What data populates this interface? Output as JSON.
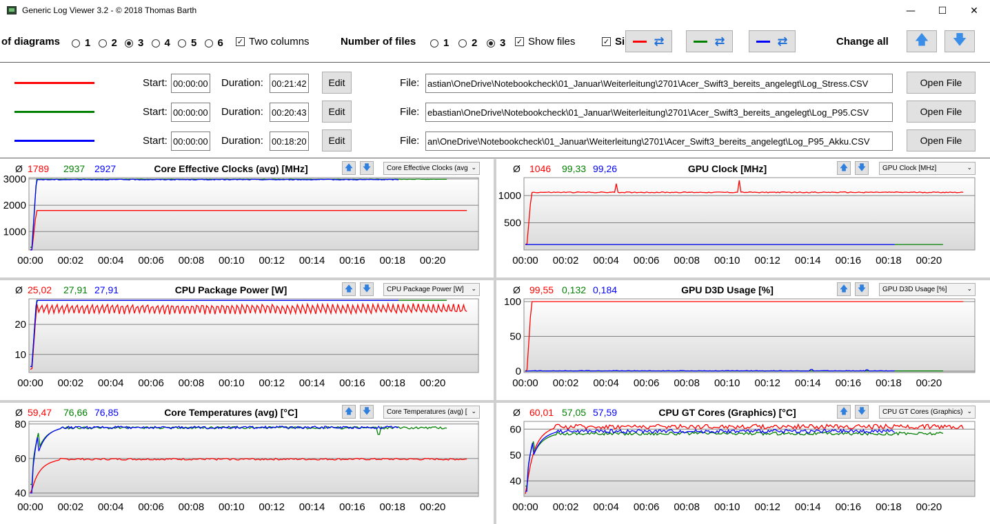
{
  "window": {
    "title": "Generic Log Viewer 3.2 - © 2018 Thomas Barth",
    "minimize": "—",
    "maximize": "☐",
    "close": "✕"
  },
  "toolbar": {
    "diagrams_label": "of diagrams",
    "diagram_options": [
      "1",
      "2",
      "3",
      "4",
      "5",
      "6"
    ],
    "diagram_selected": "3",
    "two_columns_label": "Two columns",
    "two_columns_checked": true,
    "files_label": "Number of files",
    "file_options": [
      "1",
      "2",
      "3"
    ],
    "files_selected": "3",
    "show_files_label": "Show files",
    "show_files_checked": true,
    "si_label": "Si",
    "si_checked": true,
    "change_all_label": "Change all",
    "check_glyph": "✓"
  },
  "files": [
    {
      "color": "#ff0000",
      "start_label": "Start:",
      "start": "00:00:00",
      "duration_label": "Duration:",
      "duration": "00:21:42",
      "edit_label": "Edit",
      "file_label": "File:",
      "path": "astian\\OneDrive\\Notebookcheck\\01_Januar\\Weiterleitung\\2701\\Acer_Swift3_bereits_angelegt\\Log_Stress.CSV",
      "open_label": "Open File"
    },
    {
      "color": "#008000",
      "start_label": "Start:",
      "start": "00:00:00",
      "duration_label": "Duration:",
      "duration": "00:20:43",
      "edit_label": "Edit",
      "file_label": "File:",
      "path": "ebastian\\OneDrive\\Notebookcheck\\01_Januar\\Weiterleitung\\2701\\Acer_Swift3_bereits_angelegt\\Log_P95.CSV",
      "open_label": "Open File"
    },
    {
      "color": "#0000ff",
      "start_label": "Start:",
      "start": "00:00:00",
      "duration_label": "Duration:",
      "duration": "00:18:20",
      "edit_label": "Edit",
      "file_label": "File:",
      "path": "an\\OneDrive\\Notebookcheck\\01_Januar\\Weiterleitung\\2701\\Acer_Swift3_bereits_angelegt\\Log_P95_Akku.CSV",
      "open_label": "Open File"
    }
  ],
  "colors": {
    "red": "#ff0000",
    "green": "#008000",
    "blue": "#0000ff"
  },
  "chart_data": [
    {
      "type": "line",
      "title": "Core Effective Clocks (avg) [MHz]",
      "select": "Core Effective Clocks (avg",
      "avg_symbol": "Ø",
      "averages": [
        "1789",
        "2937",
        "2927"
      ],
      "x_ticks": [
        "00:00",
        "00:02",
        "00:04",
        "00:06",
        "00:08",
        "00:10",
        "00:12",
        "00:14",
        "00:16",
        "00:18",
        "00:20"
      ],
      "y_ticks": [
        1000,
        2000,
        3000
      ],
      "ylim": [
        300,
        3050
      ],
      "xlim_min": [
        0,
        22
      ],
      "series": [
        {
          "color": "#ff0000",
          "duration_min": 21.7,
          "start": 300,
          "level": 1800,
          "noise": 0,
          "spikes": []
        },
        {
          "color": "#008000",
          "duration_min": 20.7,
          "start": 400,
          "level": 2990,
          "noise": 10,
          "spikes": []
        },
        {
          "color": "#0000ff",
          "duration_min": 18.3,
          "start": 300,
          "level": 2975,
          "noise": 15,
          "spikes": []
        }
      ]
    },
    {
      "type": "line",
      "title": "GPU Clock [MHz]",
      "select": "GPU Clock [MHz]",
      "avg_symbol": "Ø",
      "averages": [
        "1046",
        "99,33",
        "99,26"
      ],
      "x_ticks": [
        "00:00",
        "00:02",
        "00:04",
        "00:06",
        "00:08",
        "00:10",
        "00:12",
        "00:14",
        "00:16",
        "00:18",
        "00:20"
      ],
      "y_ticks": [
        500,
        1000
      ],
      "ylim": [
        0,
        1330
      ],
      "xlim_min": [
        0,
        22
      ],
      "series": [
        {
          "color": "#ff0000",
          "duration_min": 21.7,
          "start": 100,
          "level": 1060,
          "noise": 8,
          "spikes": [
            [
              4.5,
              1220
            ],
            [
              10.6,
              1280
            ]
          ]
        },
        {
          "color": "#008000",
          "duration_min": 20.7,
          "start": 100,
          "level": 100,
          "noise": 0,
          "spikes": []
        },
        {
          "color": "#0000ff",
          "duration_min": 18.3,
          "start": 100,
          "level": 100,
          "noise": 0,
          "spikes": []
        }
      ]
    },
    {
      "type": "line",
      "title": "CPU Package Power [W]",
      "select": "CPU Package Power [W]",
      "avg_symbol": "Ø",
      "averages": [
        "25,02",
        "27,91",
        "27,91"
      ],
      "x_ticks": [
        "00:00",
        "00:02",
        "00:04",
        "00:06",
        "00:08",
        "00:10",
        "00:12",
        "00:14",
        "00:16",
        "00:18",
        "00:20"
      ],
      "y_ticks": [
        10,
        20
      ],
      "ylim": [
        4,
        28.5
      ],
      "xlim_min": [
        0,
        22
      ],
      "series": [
        {
          "color": "#ff0000",
          "duration_min": 21.7,
          "start": 5,
          "level": 25.2,
          "noise": 1.6,
          "spikes": []
        },
        {
          "color": "#008000",
          "duration_min": 20.7,
          "start": 6,
          "level": 28,
          "noise": 0,
          "spikes": []
        },
        {
          "color": "#0000ff",
          "duration_min": 18.3,
          "start": 6,
          "level": 28,
          "noise": 0,
          "spikes": []
        }
      ]
    },
    {
      "type": "line",
      "title": "GPU D3D Usage [%]",
      "select": "GPU D3D Usage [%]",
      "avg_symbol": "Ø",
      "averages": [
        "99,55",
        "0,132",
        "0,184"
      ],
      "x_ticks": [
        "00:00",
        "00:02",
        "00:04",
        "00:06",
        "00:08",
        "00:10",
        "00:12",
        "00:14",
        "00:16",
        "00:18",
        "00:20"
      ],
      "y_ticks": [
        0,
        50,
        100
      ],
      "ylim": [
        -2,
        104
      ],
      "xlim_min": [
        0,
        22
      ],
      "series": [
        {
          "color": "#ff0000",
          "duration_min": 21.7,
          "start": 0,
          "level": 100,
          "noise": 0,
          "spikes": []
        },
        {
          "color": "#008000",
          "duration_min": 20.7,
          "start": 0,
          "level": 0.3,
          "noise": 0,
          "spikes": []
        },
        {
          "color": "#0000ff",
          "duration_min": 18.3,
          "start": 0,
          "level": 0.4,
          "noise": 0.4,
          "spikes": [
            [
              14.2,
              2.5
            ],
            [
              16.9,
              2
            ]
          ]
        }
      ]
    },
    {
      "type": "line",
      "title": "Core Temperatures (avg) [°C]",
      "select": "Core Temperatures (avg) [",
      "avg_symbol": "Ø",
      "averages": [
        "59,47",
        "76,66",
        "76,85"
      ],
      "x_ticks": [
        "00:00",
        "00:02",
        "00:04",
        "00:06",
        "00:08",
        "00:10",
        "00:12",
        "00:14",
        "00:16",
        "00:18",
        "00:20"
      ],
      "y_ticks": [
        40,
        60,
        80
      ],
      "ylim": [
        38,
        81.5
      ],
      "xlim_min": [
        0,
        22
      ],
      "series": [
        {
          "color": "#ff0000",
          "duration_min": 21.7,
          "start": 40,
          "level": 59.6,
          "noise": 0.5,
          "spikes": []
        },
        {
          "color": "#008000",
          "duration_min": 20.7,
          "start": 45,
          "level": 77.8,
          "noise": 0.7,
          "spikes": [
            [
              17.3,
              74
            ]
          ]
        },
        {
          "color": "#0000ff",
          "duration_min": 18.3,
          "start": 40,
          "level": 78,
          "noise": 0.7,
          "spikes": []
        }
      ]
    },
    {
      "type": "line",
      "title": "CPU GT Cores (Graphics) [°C]",
      "select": "CPU GT Cores (Graphics)",
      "avg_symbol": "Ø",
      "averages": [
        "60,01",
        "57,05",
        "57,59"
      ],
      "x_ticks": [
        "00:00",
        "00:02",
        "00:04",
        "00:06",
        "00:08",
        "00:10",
        "00:12",
        "00:14",
        "00:16",
        "00:18",
        "00:20"
      ],
      "y_ticks": [
        40,
        50,
        60
      ],
      "ylim": [
        34,
        63
      ],
      "xlim_min": [
        0,
        22
      ],
      "series": [
        {
          "color": "#ff0000",
          "duration_min": 21.7,
          "start": 35,
          "level": 61,
          "noise": 0.9,
          "spikes": []
        },
        {
          "color": "#008000",
          "duration_min": 20.7,
          "start": 38,
          "level": 58.3,
          "noise": 0.6,
          "spikes": []
        },
        {
          "color": "#0000ff",
          "duration_min": 18.3,
          "start": 36,
          "level": 59.2,
          "noise": 0.7,
          "spikes": []
        }
      ]
    }
  ]
}
